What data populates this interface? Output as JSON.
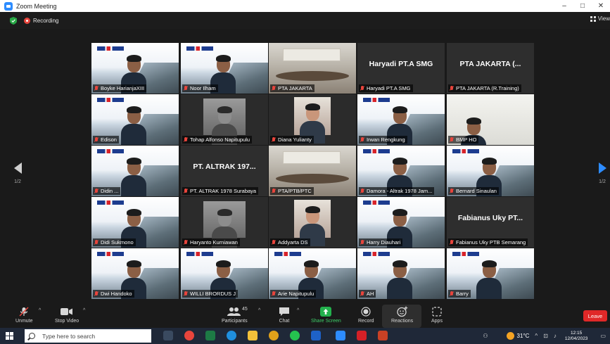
{
  "window": {
    "title": "Zoom Meeting",
    "controls": [
      "–",
      "□",
      "✕"
    ]
  },
  "meeting": {
    "recording_label": "Recording",
    "view_label": "View"
  },
  "pagination": {
    "left": "1/2",
    "right": "1/2"
  },
  "tiles": [
    {
      "name": "Boyke HarianjaXIII",
      "style": "slide"
    },
    {
      "name": "Noor Ilham",
      "style": "slide"
    },
    {
      "name": "PTA JAKARTA",
      "style": "room"
    },
    {
      "name": "Haryadi PT.A SMG",
      "style": "text",
      "display": "Haryadi PT.A SMG"
    },
    {
      "name": "PTA JAKARTA (R.Training)",
      "style": "text",
      "display": "PTA JAKARTA (..."
    },
    {
      "name": "Edison",
      "style": "slide"
    },
    {
      "name": "Tohap Alfonso Napitupulu",
      "style": "mono"
    },
    {
      "name": "Diana Yulianty",
      "style": "photo"
    },
    {
      "name": "Irwan Rengkung",
      "style": "slide"
    },
    {
      "name": "BMP HO",
      "style": "office"
    },
    {
      "name": "Didin ...",
      "style": "slide"
    },
    {
      "name": "PT. ALTRAK 1978 Surabaya",
      "style": "text",
      "display": "PT. ALTRAK 197..."
    },
    {
      "name": "PTA/PTB/PTC",
      "style": "room",
      "active": true
    },
    {
      "name": "Damora - Altrak 1978 Jam...",
      "style": "slide"
    },
    {
      "name": "Bernard Sinaulan",
      "style": "slide"
    },
    {
      "name": "Didi Sukmono",
      "style": "slide"
    },
    {
      "name": "Haryanto Kurniawan",
      "style": "mono"
    },
    {
      "name": "Addyarta DS",
      "style": "photo"
    },
    {
      "name": "Harry Diauhari",
      "style": "slide"
    },
    {
      "name": "Fabianus Uky PTB Semarang",
      "style": "text",
      "display": "Fabianus Uky PT..."
    },
    {
      "name": "Dwi Handoko",
      "style": "slide"
    },
    {
      "name": "WILLI BRORDUS J",
      "style": "slide"
    },
    {
      "name": "Arie Napitupulu",
      "style": "slide"
    },
    {
      "name": "AH",
      "style": "slide"
    },
    {
      "name": "Barry",
      "style": "slide"
    }
  ],
  "toolbar": {
    "unmute": "Unmute",
    "stop_video": "Stop Video",
    "participants": "Participants",
    "participant_count": "45",
    "chat": "Chat",
    "share_screen": "Share Screen",
    "record": "Record",
    "reactions": "Reactions",
    "apps": "Apps",
    "leave": "Leave"
  },
  "taskbar": {
    "search_placeholder": "Type here to search",
    "temperature": "31°C",
    "time": "12:15",
    "date": "12/04/2023"
  },
  "colors": {
    "active_border": "#b7d95a",
    "leave": "#e02828",
    "share_green": "#3ecf6a",
    "recording": "#e8453c",
    "zoom_blue": "#2d8cff"
  }
}
